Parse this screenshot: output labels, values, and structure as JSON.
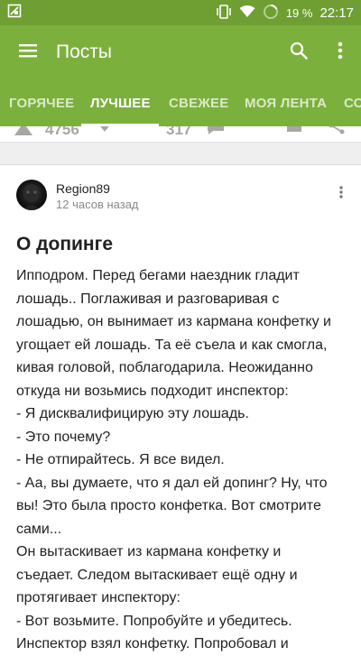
{
  "statusbar": {
    "battery_percent": "19 %",
    "time": "22:17"
  },
  "appbar": {
    "title": "Посты"
  },
  "tabs": [
    {
      "label": "ГОРЯЧЕЕ"
    },
    {
      "label": "ЛУЧШЕЕ",
      "active": true
    },
    {
      "label": "СВЕЖЕЕ"
    },
    {
      "label": "МОЯ ЛЕНТА"
    },
    {
      "label": "СООБЩЕСТВА"
    }
  ],
  "previous_post": {
    "rating": "4756",
    "comments": "317"
  },
  "post": {
    "author": "Region89",
    "time": "12 часов назад",
    "title": "О допинге",
    "lines": [
      "Ипподром. Перед бегами наездник гладит",
      "лошадь.. Поглаживая и разговаривая с",
      "лошадью, он вынимает из кармана конфетку и",
      "угощает ей лошадь. Та её съела и как смогла,",
      "кивая головой, поблагодарила. Неожиданно",
      "откуда ни возьмись подходит инспектор:",
      "- Я дисквалифицирую эту лошадь.",
      "- Это почему?",
      "- Не отпирайтесь. Я все видел.",
      "- Аа, вы думаете, что я дал ей допинг? Ну, что",
      "вы! Это была просто конфетка. Вот смотрите",
      "сами...",
      "Он вытаскивает из кармана конфетку и",
      "съедает. Следом вытаскивает ещё одну и",
      "протягивает инспектору:",
      "- Вот возьмите. Попробуйте и убедитесь.",
      "Инспектор взял конфетку. Попробовал и"
    ]
  },
  "colors": {
    "statusbar": "#6f9e32",
    "toolbar": "#7bb03c",
    "text": "#222222",
    "muted": "#8a8a8a"
  }
}
